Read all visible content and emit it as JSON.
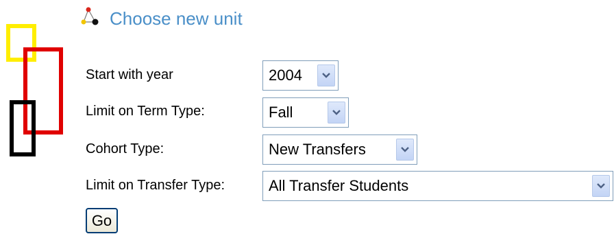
{
  "header": {
    "title": "Choose new unit",
    "icon": "network-nodes-icon"
  },
  "logo": {
    "icon": "overlapping-rectangles-logo",
    "colors": [
      "#ffee00",
      "#e00000",
      "#000000"
    ]
  },
  "form": {
    "start_year": {
      "label": "Start with year",
      "selected": "2004"
    },
    "term_type": {
      "label": "Limit on Term Type:",
      "selected": "Fall"
    },
    "cohort_type": {
      "label": "Cohort Type:",
      "selected": "New Transfers"
    },
    "transfer_type": {
      "label": "Limit on Transfer Type:",
      "selected": "All Transfer Students"
    },
    "go_label": "Go"
  },
  "colors": {
    "title": "#4a8fc8",
    "select_border": "#7f9db9",
    "dropdown_button": "#c3d4f5",
    "dropdown_arrow": "#4d6185"
  }
}
